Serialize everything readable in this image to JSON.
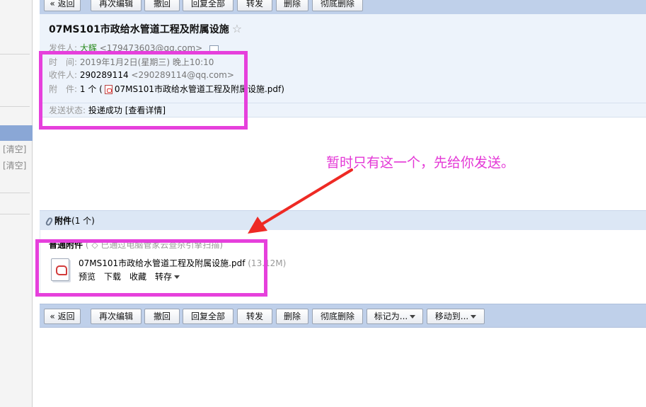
{
  "toolbar": {
    "back": "« 返回",
    "reedit": "再次编辑",
    "recall": "撤回",
    "reply_all": "回复全部",
    "forward": "转发",
    "delete": "删除",
    "delete_perm": "彻底删除",
    "mark_as": "标记为...",
    "move_to": "移动到..."
  },
  "sidebar": {
    "clear_1": "[清空]",
    "clear_2": "[清空]"
  },
  "mail": {
    "subject": "07MS101市政给水管道工程及附属设施",
    "star": "☆",
    "sender_label": "发件人:",
    "sender_name": "大辉",
    "sender_email": "<179473603@qq.com>",
    "time_label": "时　间:",
    "time_value": "2019年1月2日(星期三) 晚上10:10",
    "to_label": "收件人:",
    "to_name": "290289114",
    "to_email": "<290289114@qq.com>",
    "attach_label": "附　件:",
    "attach_count": "1 个 (",
    "attach_file": "07MS101市政给水管道工程及附属设施.pdf)",
    "status_label": "发送状态:",
    "status_value": "投递成功",
    "status_detail": "[查看详情]"
  },
  "annotation": {
    "text": "暂时只有这一个，先给你发送。",
    "color": "#e437d6"
  },
  "attachments": {
    "title": "附件",
    "count": "(1 个)",
    "section_label": "普通附件",
    "section_note": "( ◇ 已通过电脑管家云查杀引擎扫描)",
    "file_name": "07MS101市政给水管道工程及附属设施.pdf",
    "file_size": "(13.12M)",
    "preview": "预览",
    "download": "下载",
    "favorite": "收藏",
    "save_to": "转存"
  }
}
